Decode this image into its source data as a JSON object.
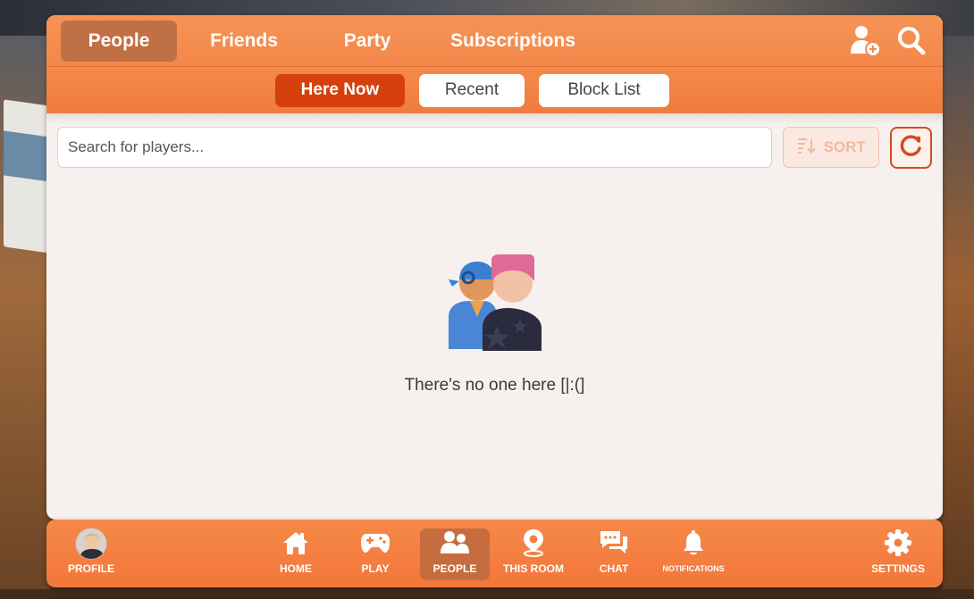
{
  "top_tabs": [
    {
      "label": "People",
      "active": true
    },
    {
      "label": "Friends",
      "active": false
    },
    {
      "label": "Party",
      "active": false
    },
    {
      "label": "Subscriptions",
      "active": false
    }
  ],
  "top_icons": [
    "add-friend-icon",
    "search-icon"
  ],
  "sub_tabs": [
    {
      "label": "Here Now",
      "active": true
    },
    {
      "label": "Recent",
      "active": false
    },
    {
      "label": "Block List",
      "active": false
    }
  ],
  "search": {
    "placeholder": "Search for players...",
    "value": ""
  },
  "sort": {
    "label": "SORT",
    "icon": "sort-icon",
    "disabled": true
  },
  "refresh": {
    "icon": "refresh-icon"
  },
  "empty_state": {
    "icon": "people-icon",
    "message": "There's no one here [|:(]"
  },
  "bottom_nav": [
    {
      "label": "PROFILE",
      "icon": "avatar"
    },
    {
      "label": "HOME",
      "icon": "home-icon"
    },
    {
      "label": "PLAY",
      "icon": "gamepad-icon"
    },
    {
      "label": "PEOPLE",
      "icon": "people-icon",
      "active": true
    },
    {
      "label": "THIS ROOM",
      "icon": "location-pin-icon"
    },
    {
      "label": "CHAT",
      "icon": "chat-icon"
    },
    {
      "label": "NOTIFICATIONS",
      "icon": "bell-icon"
    },
    {
      "label": "SETTINGS",
      "icon": "gear-icon"
    }
  ],
  "colors": {
    "accent": "#f3874a",
    "active_tab": "#c07045",
    "active_subtab": "#d5400c",
    "panel_bg": "#f6f1ef"
  }
}
